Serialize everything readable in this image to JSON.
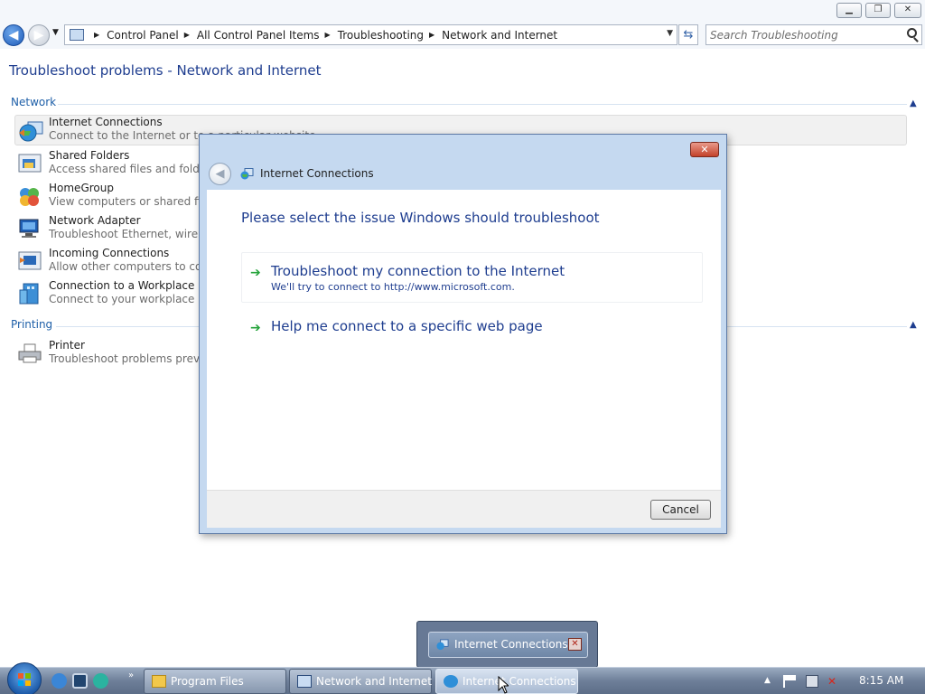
{
  "window": {
    "buttons": {
      "minimize_icon": "minimize-icon",
      "maximize_icon": "restore-icon",
      "close_icon": "close-icon"
    }
  },
  "navbar": {
    "breadcrumbs": [
      "Control Panel",
      "All Control Panel Items",
      "Troubleshooting",
      "Network and Internet"
    ],
    "search_placeholder": "Search Troubleshooting"
  },
  "main": {
    "title": "Troubleshoot problems - Network and Internet",
    "groups": [
      {
        "name": "Network",
        "items": [
          {
            "title": "Internet Connections",
            "desc": "Connect to the Internet or to a particular website"
          },
          {
            "title": "Shared Folders",
            "desc": "Access shared files and folders o"
          },
          {
            "title": "HomeGroup",
            "desc": "View computers or shared files i"
          },
          {
            "title": "Network Adapter",
            "desc": "Troubleshoot Ethernet, wireless,"
          },
          {
            "title": "Incoming Connections",
            "desc": "Allow other computers to comm"
          },
          {
            "title": "Connection to a Workplace Usin",
            "desc": "Connect to your workplace netw"
          }
        ]
      },
      {
        "name": "Printing",
        "items": [
          {
            "title": "Printer",
            "desc": "Troubleshoot problems prevent"
          }
        ]
      }
    ]
  },
  "dialog": {
    "title": "Internet Connections",
    "heading": "Please select the issue Windows should troubleshoot",
    "options": [
      {
        "title": "Troubleshoot my connection to the Internet",
        "desc": "We'll try to connect to http://www.microsoft.com."
      },
      {
        "title": "Help me connect to a specific web page",
        "desc": ""
      }
    ],
    "cancel_label": "Cancel"
  },
  "taskbar": {
    "thumbnail_label": "Internet Connections",
    "buttons": [
      "Program Files",
      "Network and Internet",
      "Internet Connections"
    ],
    "clock": "8:15 AM"
  },
  "colors": {
    "accent": "#1e3d8f",
    "group_heading": "#1e5fa8",
    "option_arrow": "#24a33a",
    "taskbar": "#6e7f99"
  }
}
